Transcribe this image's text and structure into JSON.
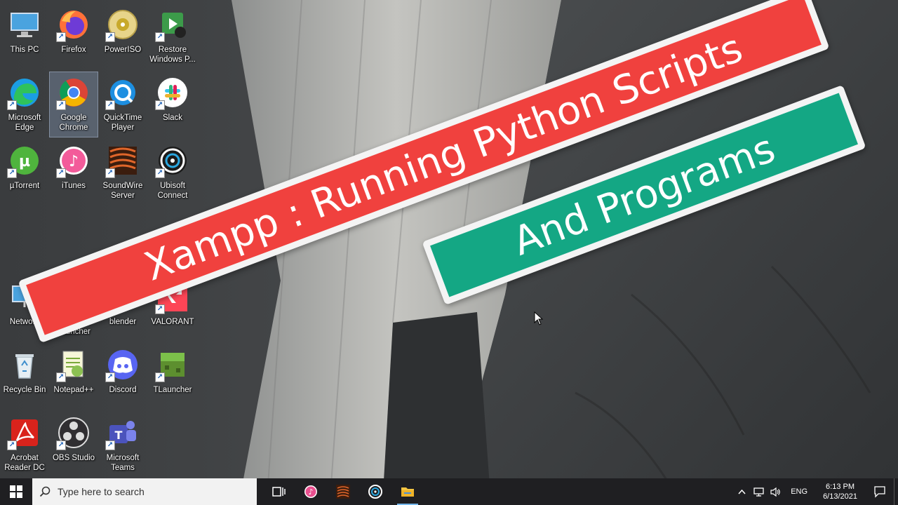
{
  "desktop": {
    "icons": [
      {
        "label": "This PC",
        "icon": "this-pc-icon"
      },
      {
        "label": "Firefox",
        "icon": "firefox-icon"
      },
      {
        "label": "PowerISO",
        "icon": "poweriso-icon"
      },
      {
        "label": "Restore\nWindows P...",
        "icon": "restore-windows-icon"
      },
      {
        "label": "Microsoft\nEdge",
        "icon": "edge-icon"
      },
      {
        "label": "Google\nChrome",
        "icon": "chrome-icon"
      },
      {
        "label": "QuickTime\nPlayer",
        "icon": "quicktime-icon"
      },
      {
        "label": "Slack",
        "icon": "slack-icon"
      },
      {
        "label": "µTorrent",
        "icon": "utorrent-icon"
      },
      {
        "label": "iTunes",
        "icon": "itunes-icon"
      },
      {
        "label": "SoundWire\nServer",
        "icon": "soundwire-icon"
      },
      {
        "label": "Ubisoft\nConnect",
        "icon": "ubisoft-icon"
      },
      {
        "label": "Netwo...",
        "icon": "network-icon"
      },
      {
        "label": "Minecraft\nLauncher",
        "icon": "minecraft-launcher-icon"
      },
      {
        "label": "blender",
        "icon": "blender-icon"
      },
      {
        "label": "VALORANT",
        "icon": "valorant-icon"
      },
      {
        "label": "Recycle Bin",
        "icon": "recycle-bin-icon"
      },
      {
        "label": "Notepad++",
        "icon": "notepad-plus-plus-icon"
      },
      {
        "label": "Discord",
        "icon": "discord-icon"
      },
      {
        "label": "TLauncher",
        "icon": "tlauncher-icon"
      },
      {
        "label": "Acrobat\nReader DC",
        "icon": "acrobat-icon"
      },
      {
        "label": "OBS Studio",
        "icon": "obs-icon"
      },
      {
        "label": "Microsoft\nTeams",
        "icon": "teams-icon"
      }
    ]
  },
  "banners": {
    "title_line1": "Xampp : Running Python Scripts",
    "title_line2": "And Programs",
    "colors": {
      "red": "#f0413e",
      "green": "#14a784",
      "border": "#f4f4f4"
    }
  },
  "taskbar": {
    "search_placeholder": "Type here to search",
    "pinned": [
      "task-view-icon",
      "itunes-icon",
      "soundwire-icon",
      "ubisoft-icon",
      "file-explorer-icon"
    ],
    "tray": {
      "language": "ENG",
      "time": "6:13 PM",
      "date": "6/13/2021"
    }
  }
}
